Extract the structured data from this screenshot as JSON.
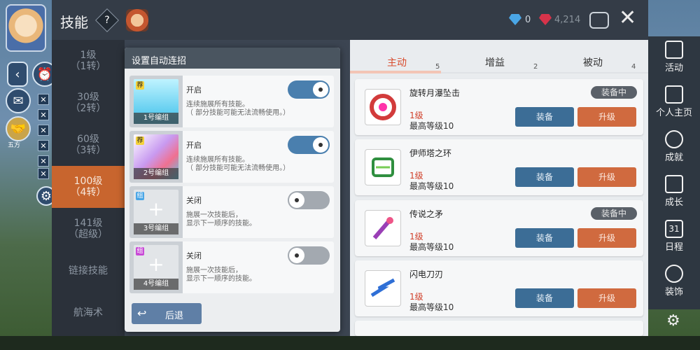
{
  "topbar": {
    "title": "技能",
    "help_icon": "?",
    "gem_blue_count": "0",
    "gem_red_count": "4,214"
  },
  "left_hud": {
    "back_icon": "‹",
    "label_under_icon": "五方"
  },
  "level_list": [
    {
      "main": "1级",
      "sub": "（1转）"
    },
    {
      "main": "30级",
      "sub": "（2转）"
    },
    {
      "main": "60级",
      "sub": "（3转）"
    },
    {
      "main": "100级",
      "sub": "（4转）"
    },
    {
      "main": "141级",
      "sub": "（超级）"
    },
    {
      "main": "链接技能",
      "sub": ""
    },
    {
      "main": "航海术",
      "sub": ""
    }
  ],
  "tabs": [
    {
      "label": "主动",
      "count": "5"
    },
    {
      "label": "增益",
      "count": "2"
    },
    {
      "label": "被动",
      "count": "4"
    }
  ],
  "skills": [
    {
      "name": "旋转月瀑坠击",
      "level": "1级",
      "max": "最高等级10",
      "equipped": "装备中",
      "equip": "装备",
      "upgrade": "升级",
      "color": "#d23b3b"
    },
    {
      "name": "伊师塔之环",
      "level": "1级",
      "max": "最高等级10",
      "equipped": "",
      "equip": "装备",
      "upgrade": "升级",
      "color": "#2f8f3f"
    },
    {
      "name": "传说之矛",
      "level": "1级",
      "max": "最高等级10",
      "equipped": "装备中",
      "equip": "装备",
      "upgrade": "升级",
      "color": "#9a3fb6"
    },
    {
      "name": "闪电刀刃",
      "level": "1级",
      "max": "最高等级10",
      "equipped": "",
      "equip": "装备",
      "upgrade": "升级",
      "color": "#2f6fd6"
    },
    {
      "name": "",
      "level": "",
      "max": "",
      "equipped": "",
      "equip": "",
      "upgrade": "",
      "color": "#888888"
    }
  ],
  "right_sidebar": [
    {
      "label": "活动"
    },
    {
      "label": "个人主页"
    },
    {
      "label": "成就"
    },
    {
      "label": "成长"
    },
    {
      "label": "日程",
      "badge": "31"
    },
    {
      "label": "装饰"
    }
  ],
  "modal": {
    "title": "设置自动连招",
    "cards": [
      {
        "tag": "荐",
        "name": "1号编组",
        "state": "开启",
        "desc": "连续施展所有技能。\n（ 部分技能可能无法流畅使用。）",
        "enabled": true,
        "empty": false
      },
      {
        "tag": "荐",
        "name": "2号编组",
        "state": "开启",
        "desc": "连续施展所有技能。\n（ 部分技能可能无法流畅使用。）",
        "enabled": true,
        "empty": false
      },
      {
        "tag": "组",
        "name": "3号编组",
        "state": "关闭",
        "desc": "施展一次技能后，\n显示下一顺序的技能。",
        "enabled": false,
        "empty": true
      },
      {
        "tag": "组",
        "name": "4号编组",
        "state": "关闭",
        "desc": "施展一次技能后，\n显示下一顺序的技能。",
        "enabled": false,
        "empty": true
      }
    ],
    "back_label": "后退"
  },
  "colors": {
    "accent_orange": "#c8652e",
    "toggle_on": "#4a7fae",
    "equip_blue": "#3c6d96",
    "upgrade_orange": "#d06a3f"
  }
}
